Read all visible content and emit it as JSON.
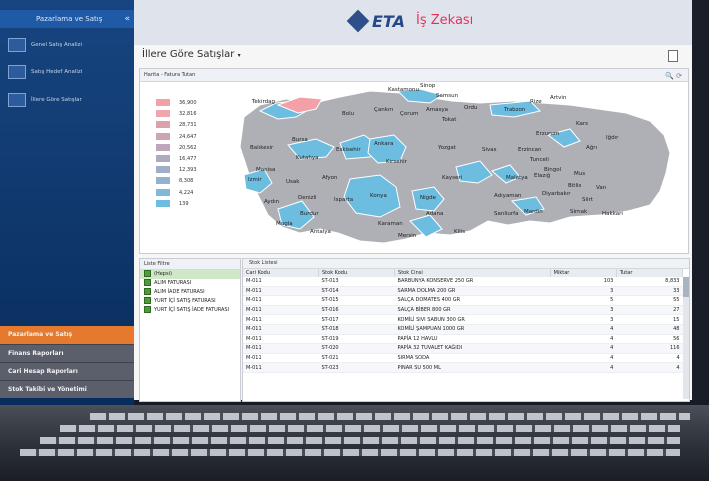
{
  "sidebar": {
    "header": "Pazarlama ve Satış",
    "collapse_glyph": "«",
    "items": [
      {
        "label": "Genel Satış Analizi",
        "icon": "chart-icon"
      },
      {
        "label": "Satış Hedef Analizi",
        "icon": "chart-icon"
      },
      {
        "label": "İllere Göre Satışlar",
        "icon": "map-icon"
      }
    ],
    "sections": [
      {
        "label": "Pazarlama ve Satış",
        "active": true
      },
      {
        "label": "Finans Raporları",
        "active": false
      },
      {
        "label": "Cari Hesap Raporları",
        "active": false
      },
      {
        "label": "Stok Takibi ve Yönetimi",
        "active": false
      }
    ]
  },
  "banner": {
    "brand": "ETA",
    "tagline": "İş Zekası"
  },
  "page": {
    "title": "İllere Göre Satışlar",
    "title_glyph": "▾"
  },
  "map": {
    "header": "Harita - Fatura Tutarı",
    "tools": "🔍 ⟳",
    "legend": [
      {
        "value": "36,900",
        "color": "#f4a0a8"
      },
      {
        "value": "32,816",
        "color": "#f0a6ae"
      },
      {
        "value": "28,731",
        "color": "#dba2ae"
      },
      {
        "value": "24,647",
        "color": "#cca4b4"
      },
      {
        "value": "20,562",
        "color": "#bea6bb"
      },
      {
        "value": "16,477",
        "color": "#aeaac2"
      },
      {
        "value": "12,393",
        "color": "#a0aec9"
      },
      {
        "value": "8,308",
        "color": "#92b2d0"
      },
      {
        "value": "4,224",
        "color": "#80b8d8"
      },
      {
        "value": "139",
        "color": "#6cbde0"
      }
    ],
    "provinces": [
      "Kastamonu",
      "Sinop",
      "Samsun",
      "Tekirdag",
      "Bolu",
      "Çankırı",
      "Çorum",
      "Amasya",
      "Ordu",
      "Trabzon",
      "Rize",
      "Artvin",
      "Tokat",
      "Kars",
      "Erzurum",
      "Iğdır",
      "Ağrı",
      "Balıkesir",
      "Bursa",
      "Eskisehir",
      "Ankara",
      "Kırsehir",
      "Yozgat",
      "Sivas",
      "Erzincan",
      "Kutahya",
      "Tunceli",
      "Bingol",
      "Mus",
      "Bitlis",
      "Van",
      "Manisa",
      "Izmir",
      "Usak",
      "Afyon",
      "Kayseri",
      "Malatya",
      "Elazığ",
      "Diyarbakır",
      "Siirt",
      "Aydın",
      "Denizli",
      "Isparta",
      "Konya",
      "Nigde",
      "Adıyaman",
      "Sanliurfa",
      "Mardin",
      "Sirnak",
      "Hakkari",
      "Burdur",
      "Mugla",
      "Antalya",
      "Karaman",
      "Adana",
      "Mersin",
      "Kilis"
    ]
  },
  "filter": {
    "header": "Liste Filtre",
    "items": [
      "(Hepsi)",
      "ALIM FATURASI",
      "ALIM İADE FATURASI",
      "YURT İÇİ SATIŞ FATURASI",
      "YURT İÇİ SATIŞ İADE FATURASI"
    ]
  },
  "stock": {
    "header": "Stok Listesi",
    "columns": [
      "Cari Kodu",
      "Stok Kodu",
      "Stok Cinsi",
      "Miktar",
      "Tutar"
    ],
    "rows": [
      [
        "M-011",
        "ST-013",
        "BARBUNYA KONSERVE 250 GR",
        "103",
        "8,833"
      ],
      [
        "M-011",
        "ST-014",
        "SARMA DOLMA 200 GR",
        "3",
        "33"
      ],
      [
        "M-011",
        "ST-015",
        "SALÇA DOMATES  400 GR",
        "5",
        "55"
      ],
      [
        "M-011",
        "ST-016",
        "SALÇA BİBER 800 GR",
        "3",
        "27"
      ],
      [
        "M-011",
        "ST-017",
        "KOMİLİ SIVI SABUN 300 GR",
        "3",
        "15"
      ],
      [
        "M-011",
        "ST-018",
        "KOMİLİ ŞAMPUAN  1000 GR",
        "4",
        "48"
      ],
      [
        "M-011",
        "ST-019",
        "PAPİA 12 HAVLU",
        "4",
        "56"
      ],
      [
        "M-011",
        "ST-020",
        "PAPİA 32 TUVALET KAĞIDI",
        "4",
        "116"
      ],
      [
        "M-011",
        "ST-021",
        "SIRMA SODA",
        "4",
        "4"
      ],
      [
        "M-011",
        "ST-023",
        "PINAR SU 500 ML",
        "4",
        "4"
      ]
    ]
  }
}
